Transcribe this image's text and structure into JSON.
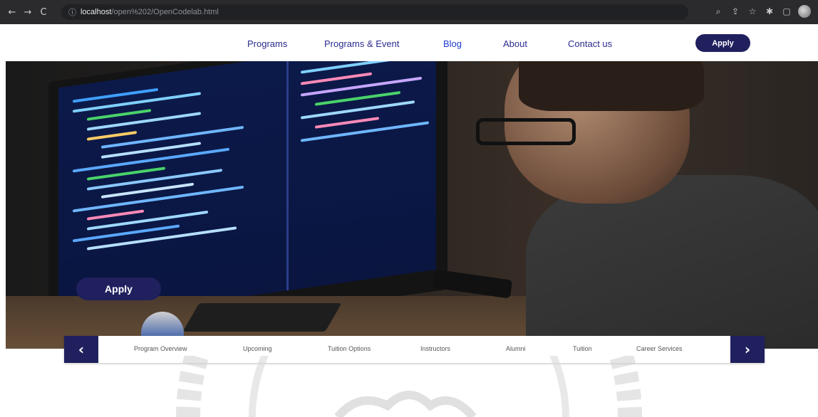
{
  "browser": {
    "url_host": "localhost",
    "url_path": "/open%202/OpenCodelab.html"
  },
  "nav": {
    "links": [
      "Programs",
      "Programs & Event",
      "Blog",
      "About",
      "Contact us"
    ],
    "apply_label": "Apply"
  },
  "hero": {
    "apply_label": "Apply"
  },
  "subnav": {
    "items": [
      "Program Overview",
      "Upcoming",
      "Tuition Options",
      "Instructors",
      "Alumni",
      "Tuition",
      "Career Services"
    ],
    "prev_icon": "chevron-left-icon",
    "next_icon": "chevron-right-icon"
  },
  "colors": {
    "brand": "#20205f",
    "chrome": "#2b2b2e"
  }
}
